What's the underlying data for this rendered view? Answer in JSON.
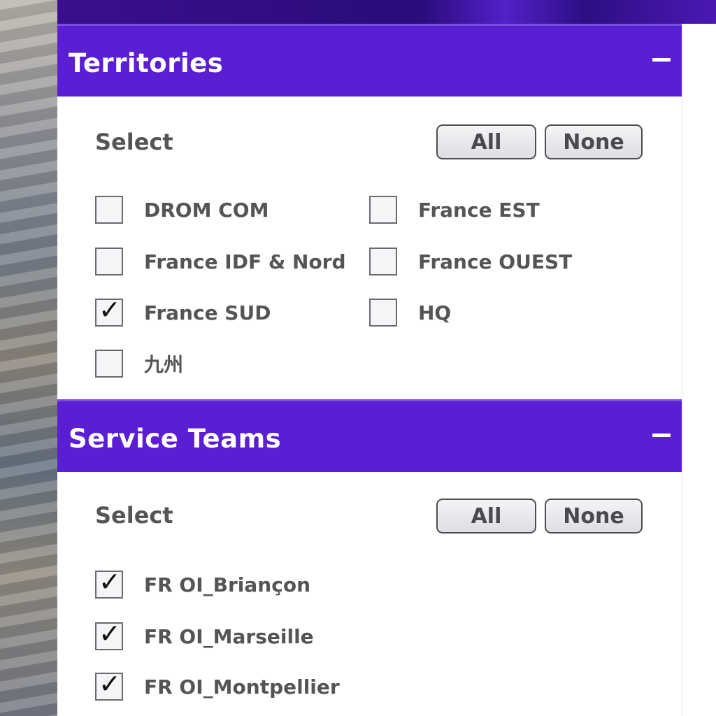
{
  "territories": {
    "title": "Territories",
    "select_label": "Select",
    "all_label": "All",
    "none_label": "None",
    "items": [
      {
        "label": "DROM COM",
        "checked": false
      },
      {
        "label": "France EST",
        "checked": false
      },
      {
        "label": "France IDF & Nord",
        "checked": false
      },
      {
        "label": "France OUEST",
        "checked": false
      },
      {
        "label": "France SUD",
        "checked": true
      },
      {
        "label": "HQ",
        "checked": false
      },
      {
        "label": "九州",
        "checked": false
      }
    ]
  },
  "service_teams": {
    "title": "Service Teams",
    "select_label": "Select",
    "all_label": "All",
    "none_label": "None",
    "items": [
      {
        "label": "FR OI_Briançon",
        "checked": true
      },
      {
        "label": "FR OI_Marseille",
        "checked": true
      },
      {
        "label": "FR OI_Montpellier",
        "checked": true
      }
    ]
  },
  "colors": {
    "header_purple": "#5a1fd3",
    "text_gray": "#555558"
  },
  "icons": {
    "collapse": "minus-icon",
    "check": "checkmark-icon"
  }
}
